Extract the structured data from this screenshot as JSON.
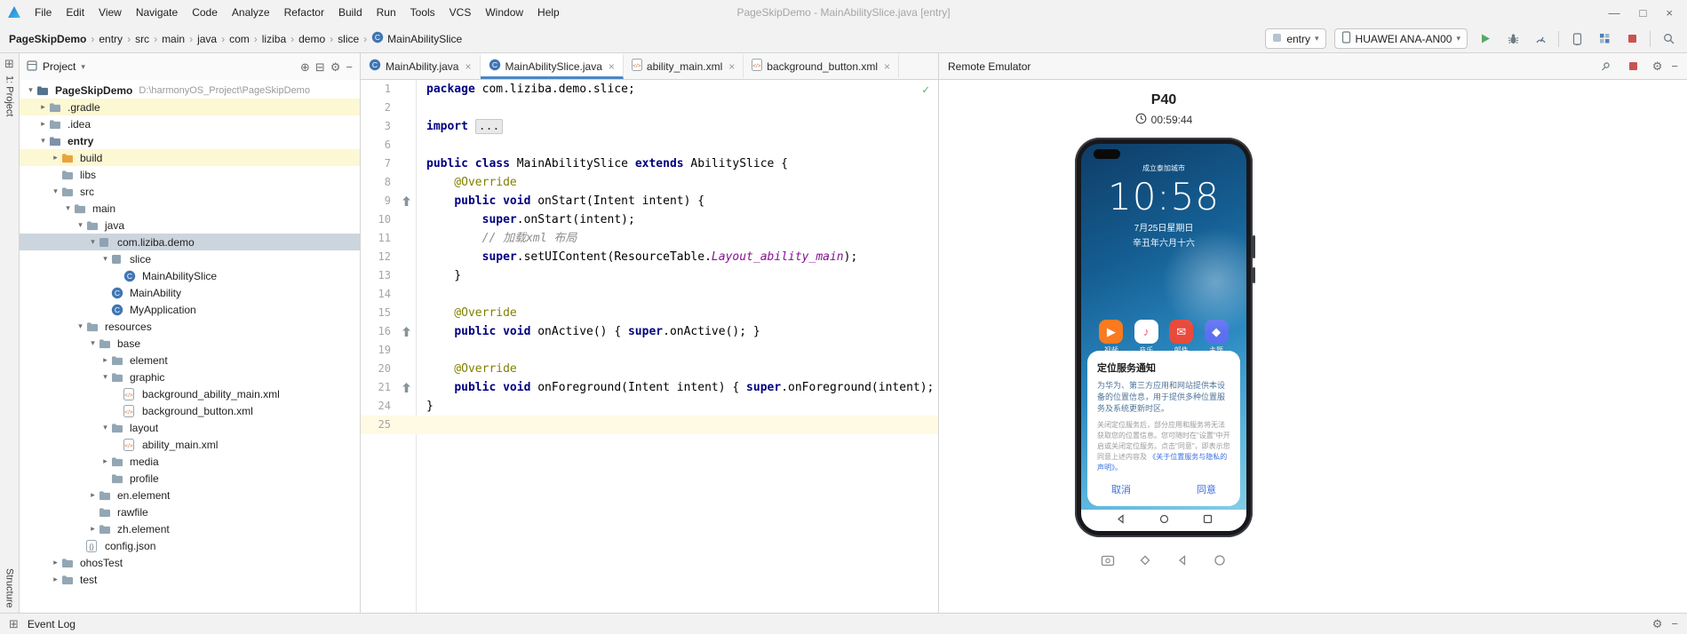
{
  "window": {
    "title": "PageSkipDemo - MainAbilitySlice.java [entry]",
    "menu_items": [
      "File",
      "Edit",
      "View",
      "Navigate",
      "Code",
      "Analyze",
      "Refactor",
      "Build",
      "Run",
      "Tools",
      "VCS",
      "Window",
      "Help"
    ]
  },
  "icons": {
    "win_min": "—",
    "win_max": "□",
    "win_close": "×",
    "gear": "⚙",
    "hide": "−",
    "locate": "⊕",
    "collapse_all": "⊟",
    "tool_windows": "⊞",
    "chevron_down": "▾",
    "chevron_expanded": "▾",
    "chevron_collapsed": "▸",
    "crumb_sep": "›",
    "tab_close": "×",
    "check": "✓"
  },
  "colors": {
    "accent_blue": "#4a86c8",
    "run_green": "#59a869",
    "stop_red": "#c75450",
    "tree_selection": "#ccd5dd",
    "tree_yellow": "#fcf8d3",
    "caret_line": "#fffae3"
  },
  "toolbar": {
    "breadcrumb": [
      "PageSkipDemo",
      "entry",
      "src",
      "main",
      "java",
      "com",
      "liziba",
      "demo",
      "slice",
      "MainAbilitySlice"
    ],
    "run_config_label": "entry",
    "device_label": "HUAWEI ANA-AN00"
  },
  "project_panel": {
    "header": "Project",
    "tool_button_top": "1: Project",
    "tool_button_bottom": "Structure",
    "tree": [
      {
        "label": "PageSkipDemo",
        "extra": "D:\\harmonyOS_Project\\PageSkipDemo",
        "depth": 0,
        "icon": "project",
        "arrow": "expanded",
        "bold": true
      },
      {
        "label": ".gradle",
        "depth": 1,
        "icon": "folder",
        "arrow": "collapsed",
        "highlight": "yellow"
      },
      {
        "label": ".idea",
        "depth": 1,
        "icon": "folder",
        "arrow": "collapsed"
      },
      {
        "label": "entry",
        "depth": 1,
        "icon": "module",
        "arrow": "expanded",
        "bold": true
      },
      {
        "label": "build",
        "depth": 2,
        "icon": "folder-orange",
        "arrow": "collapsed",
        "highlight": "yellow"
      },
      {
        "label": "libs",
        "depth": 2,
        "icon": "folder",
        "arrow": "none"
      },
      {
        "label": "src",
        "depth": 2,
        "icon": "folder",
        "arrow": "expanded"
      },
      {
        "label": "main",
        "depth": 3,
        "icon": "folder",
        "arrow": "expanded"
      },
      {
        "label": "java",
        "depth": 4,
        "icon": "folder",
        "arrow": "expanded"
      },
      {
        "label": "com.liziba.demo",
        "depth": 5,
        "icon": "package",
        "arrow": "expanded",
        "highlight": "selected"
      },
      {
        "label": "slice",
        "depth": 6,
        "icon": "package",
        "arrow": "expanded"
      },
      {
        "label": "MainAbilitySlice",
        "depth": 7,
        "icon": "class",
        "arrow": "none"
      },
      {
        "label": "MainAbility",
        "depth": 6,
        "icon": "class",
        "arrow": "none"
      },
      {
        "label": "MyApplication",
        "depth": 6,
        "icon": "class",
        "arrow": "none"
      },
      {
        "label": "resources",
        "depth": 4,
        "icon": "folder",
        "arrow": "expanded"
      },
      {
        "label": "base",
        "depth": 5,
        "icon": "folder",
        "arrow": "expanded"
      },
      {
        "label": "element",
        "depth": 6,
        "icon": "folder",
        "arrow": "collapsed"
      },
      {
        "label": "graphic",
        "depth": 6,
        "icon": "folder",
        "arrow": "expanded"
      },
      {
        "label": "background_ability_main.xml",
        "depth": 7,
        "icon": "xml",
        "arrow": "none"
      },
      {
        "label": "background_button.xml",
        "depth": 7,
        "icon": "xml",
        "arrow": "none"
      },
      {
        "label": "layout",
        "depth": 6,
        "icon": "folder",
        "arrow": "expanded"
      },
      {
        "label": "ability_main.xml",
        "depth": 7,
        "icon": "xml",
        "arrow": "none"
      },
      {
        "label": "media",
        "depth": 6,
        "icon": "folder",
        "arrow": "collapsed"
      },
      {
        "label": "profile",
        "depth": 6,
        "icon": "folder",
        "arrow": "none"
      },
      {
        "label": "en.element",
        "depth": 5,
        "icon": "folder",
        "arrow": "collapsed"
      },
      {
        "label": "rawfile",
        "depth": 5,
        "icon": "folder",
        "arrow": "none"
      },
      {
        "label": "zh.element",
        "depth": 5,
        "icon": "folder",
        "arrow": "collapsed"
      },
      {
        "label": "config.json",
        "depth": 4,
        "icon": "json",
        "arrow": "none"
      },
      {
        "label": "ohosTest",
        "depth": 2,
        "icon": "folder",
        "arrow": "collapsed"
      },
      {
        "label": "test",
        "depth": 2,
        "icon": "folder",
        "arrow": "collapsed"
      }
    ]
  },
  "editor": {
    "tabs": [
      {
        "label": "MainAbility.java",
        "icon": "class",
        "active": false
      },
      {
        "label": "MainAbilitySlice.java",
        "icon": "class",
        "active": true
      },
      {
        "label": "ability_main.xml",
        "icon": "xml",
        "active": false
      },
      {
        "label": "background_button.xml",
        "icon": "xml",
        "active": false
      }
    ],
    "inspection_ok": "✓",
    "lines": [
      {
        "n": "1",
        "s": [
          [
            "kw",
            "package"
          ],
          [
            "pl",
            " com.liziba.demo.slice;"
          ]
        ]
      },
      {
        "n": "2",
        "s": []
      },
      {
        "n": "3",
        "s": [
          [
            "kw",
            "import"
          ],
          [
            "pl",
            " "
          ],
          [
            "fold",
            "..."
          ]
        ]
      },
      {
        "n": "6",
        "s": []
      },
      {
        "n": "7",
        "s": [
          [
            "kw",
            "public class"
          ],
          [
            "pl",
            " MainAbilitySlice "
          ],
          [
            "kw",
            "extends"
          ],
          [
            "pl",
            " AbilitySlice {"
          ]
        ]
      },
      {
        "n": "8",
        "s": [
          [
            "an",
            "    @Override"
          ]
        ]
      },
      {
        "n": "9",
        "g": "ov",
        "s": [
          [
            "pl",
            "    "
          ],
          [
            "kw",
            "public void"
          ],
          [
            "pl",
            " onStart(Intent intent) {"
          ]
        ]
      },
      {
        "n": "10",
        "s": [
          [
            "pl",
            "        "
          ],
          [
            "kw",
            "super"
          ],
          [
            "pl",
            ".onStart(intent);"
          ]
        ]
      },
      {
        "n": "11",
        "s": [
          [
            "cm",
            "        // 加载xml 布局"
          ]
        ]
      },
      {
        "n": "12",
        "s": [
          [
            "pl",
            "        "
          ],
          [
            "kw",
            "super"
          ],
          [
            "pl",
            ".setUIContent(ResourceTable."
          ],
          [
            "fi",
            "Layout_ability_main"
          ],
          [
            "pl",
            ");"
          ]
        ]
      },
      {
        "n": "13",
        "s": [
          [
            "pl",
            "    }"
          ]
        ]
      },
      {
        "n": "14",
        "s": []
      },
      {
        "n": "15",
        "s": [
          [
            "an",
            "    @Override"
          ]
        ]
      },
      {
        "n": "16",
        "g": "ov",
        "s": [
          [
            "pl",
            "    "
          ],
          [
            "kw",
            "public void"
          ],
          [
            "pl",
            " onActive() { "
          ],
          [
            "kw",
            "super"
          ],
          [
            "pl",
            ".onActive(); }"
          ]
        ]
      },
      {
        "n": "19",
        "s": []
      },
      {
        "n": "20",
        "s": [
          [
            "an",
            "    @Override"
          ]
        ]
      },
      {
        "n": "21",
        "g": "ov",
        "s": [
          [
            "pl",
            "    "
          ],
          [
            "kw",
            "public void"
          ],
          [
            "pl",
            " onForeground(Intent intent) { "
          ],
          [
            "kw",
            "super"
          ],
          [
            "pl",
            ".onForeground(intent); }"
          ]
        ]
      },
      {
        "n": "24",
        "s": [
          [
            "pl",
            "}"
          ]
        ]
      },
      {
        "n": "25",
        "caret": true,
        "s": []
      }
    ]
  },
  "emulator": {
    "panel_title": "Remote Emulator",
    "device_name": "P40",
    "countdown": "00:59:44",
    "phone": {
      "carrier_text": "成立泰加城市",
      "time": "10:58",
      "date": "7月25日星期日",
      "lunar": "辛丑年六月十六",
      "apps": [
        {
          "label": "视频",
          "glyph": "▶",
          "bg": "#f97a1f",
          "fg": "#ffffff"
        },
        {
          "label": "音乐",
          "glyph": "♪",
          "bg": "#ffffff",
          "fg": "#f3556e"
        },
        {
          "label": "邮件",
          "glyph": "✉",
          "bg": "#e84a3c",
          "fg": "#ffffff"
        },
        {
          "label": "主题",
          "glyph": "◆",
          "bg": "#5b6ff0",
          "fg": "#ffffff"
        }
      ],
      "dialog": {
        "title": "定位服务通知",
        "body": "为华为、第三方应用和网站提供本设备的位置信息，用于提供多种位置服务及系统更新时区。",
        "fine_print": "关闭定位服务后，部分应用和服务将无法获取您的位置信息。您可随时在\"设置\"中开启或关闭定位服务。点击\"同意\"，即表示您同意上述内容及",
        "fine_print_link": "《关于位置服务与隐私的声明》。",
        "cancel_label": "取消",
        "agree_label": "同意"
      }
    },
    "controls": [
      "screenshot",
      "rotate",
      "back",
      "home"
    ]
  },
  "status_bar": {
    "event_log": "Event Log"
  }
}
